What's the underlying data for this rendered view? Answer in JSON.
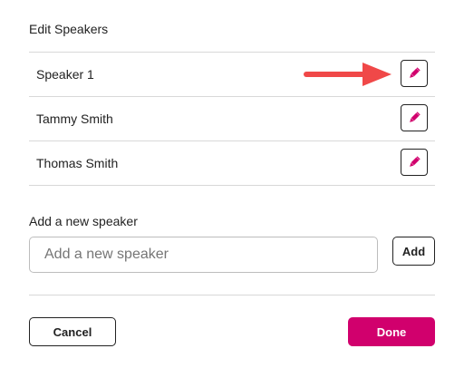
{
  "dialog": {
    "title": "Edit Speakers"
  },
  "speakers": [
    {
      "name": "Speaker 1",
      "edit_icon": "pencil-icon"
    },
    {
      "name": "Tammy Smith",
      "edit_icon": "pencil-icon"
    },
    {
      "name": "Thomas Smith",
      "edit_icon": "pencil-icon"
    }
  ],
  "add_speaker": {
    "label": "Add a new speaker",
    "value": "",
    "placeholder": "Add a new speaker",
    "button_label": "Add"
  },
  "footer": {
    "cancel_label": "Cancel",
    "done_label": "Done"
  },
  "colors": {
    "accent": "#d1006d",
    "callout_arrow": "#f04848",
    "divider": "#d8d8d8"
  }
}
